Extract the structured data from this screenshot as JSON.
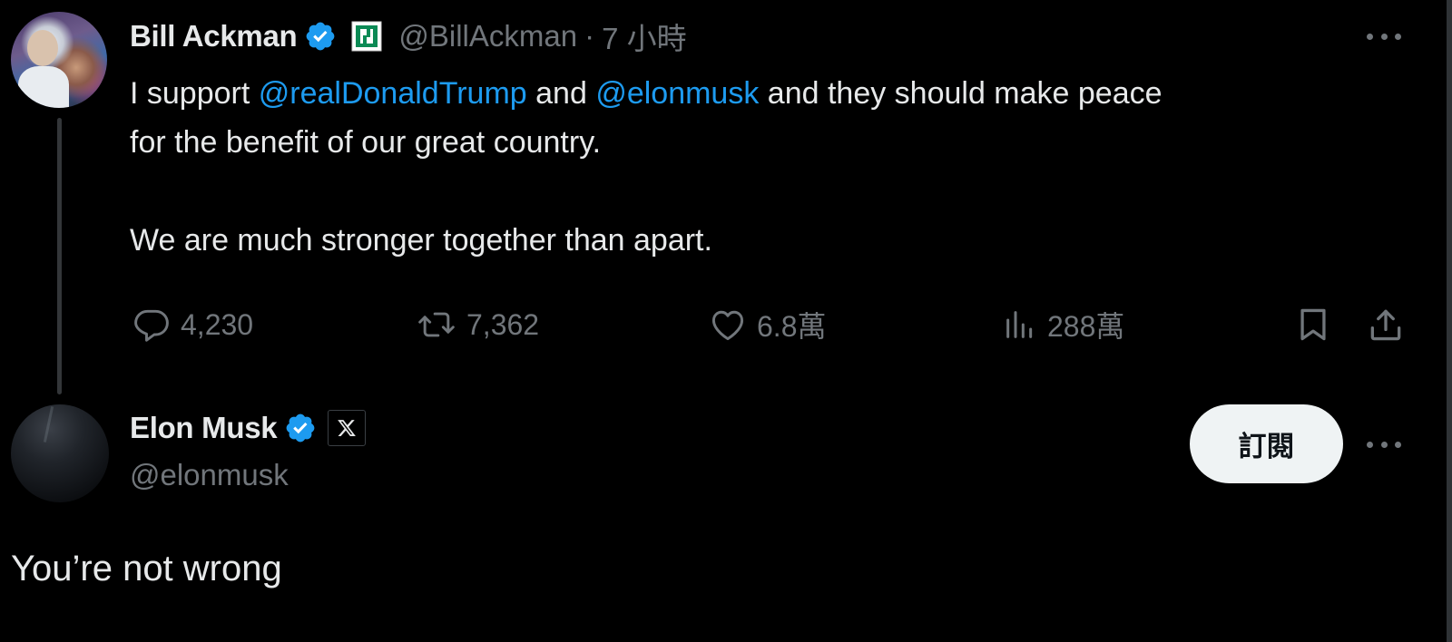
{
  "tweet1": {
    "author_name": "Bill Ackman",
    "handle": "@BillAckman",
    "separator": "·",
    "time": "7 小時",
    "line1_prefix": "I support ",
    "mention1": "@realDonaldTrump",
    "line1_mid": " and ",
    "mention2": "@elonmusk",
    "line1_suffix": " and they should make peace",
    "line2": "for the benefit of our great country.",
    "line3": "We are much stronger together than apart.",
    "actions": {
      "replies": "4,230",
      "retweets": "7,362",
      "likes": "6.8萬",
      "views": "288萬"
    }
  },
  "tweet2": {
    "author_name": "Elon Musk",
    "handle": "@elonmusk",
    "subscribe_label": "訂閱",
    "text": "You’re not wrong"
  },
  "colors": {
    "background": "#000000",
    "text": "#e7e9ea",
    "muted": "#71767b",
    "link": "#1d9bf0",
    "verified": "#1d9bf0",
    "affiliate": "#0b8a55",
    "button_bg": "#eff3f4"
  },
  "icons": {
    "reply": "reply-icon",
    "retweet": "retweet-icon",
    "like": "heart-icon",
    "views": "views-chart-icon",
    "bookmark": "bookmark-icon",
    "share": "share-icon",
    "more": "more-dots-icon",
    "verified": "verified-badge-icon",
    "x_affiliation": "x-logo-icon",
    "ackman_affiliation": "pershing-square-badge-icon"
  }
}
